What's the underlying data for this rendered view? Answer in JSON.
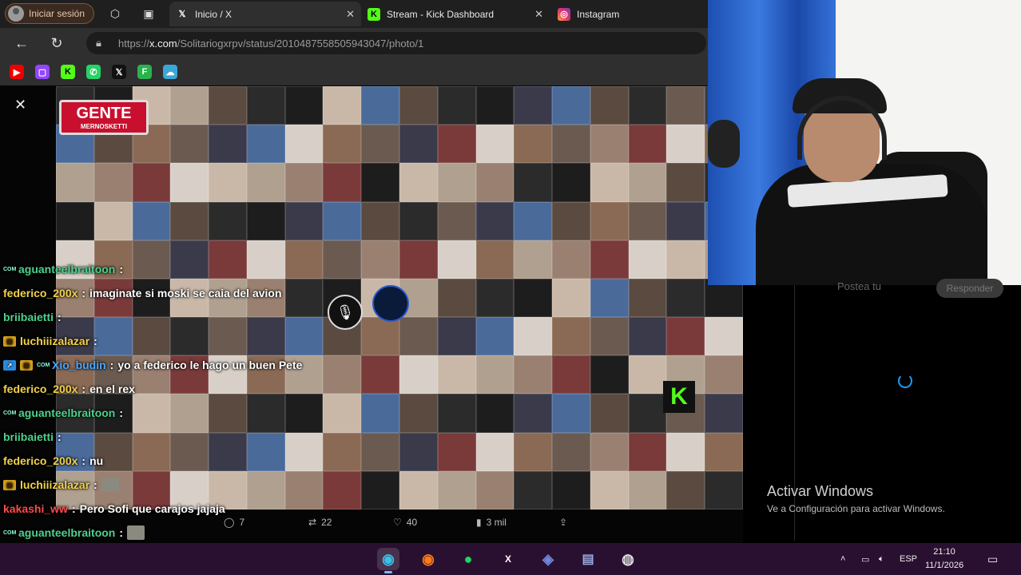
{
  "browser": {
    "profile_label": "Iniciar sesión",
    "tabs": [
      {
        "label": "Inicio / X",
        "icon": "x-logo-icon",
        "active": true
      },
      {
        "label": "Stream - Kick Dashboard",
        "icon": "kick-logo-icon",
        "active": false
      },
      {
        "label": "Instagram",
        "icon": "instagram-logo-icon",
        "active": false
      }
    ],
    "url_domain": "x.com",
    "url_prefix": "https://",
    "url_path": "/Solitariogxrpv/status/2010487558505943047/photo/1",
    "bookmarks": [
      "youtube",
      "twitch",
      "kick",
      "whatsapp",
      "x",
      "feedly",
      "cloud"
    ]
  },
  "post": {
    "banner_title": "GENTE",
    "banner_subtitle": "MERNOSKETTI",
    "actions": {
      "replies": "7",
      "reposts": "22",
      "likes": "40",
      "views": "3 mil"
    }
  },
  "chat": [
    {
      "user": "aguanteelbraitoon",
      "sep": ":",
      "text": "",
      "color": "green",
      "badges": [
        "com"
      ]
    },
    {
      "user": "federico_200x",
      "sep": ":",
      "text": "imaginate si moski se caia del avion",
      "color": "yellow",
      "badges": []
    },
    {
      "user": "briibaietti",
      "sep": ":",
      "text": "",
      "color": "green",
      "badges": []
    },
    {
      "user": "luchiiizalazar",
      "sep": ":",
      "text": "",
      "color": "yellow",
      "badges": [
        "gold"
      ]
    },
    {
      "user": "Xio_budin",
      "sep": ":",
      "text": "yo a federico le hago un buen Pete",
      "color": "blue",
      "badges": [
        "blue",
        "gold",
        "com"
      ]
    },
    {
      "user": "federico_200x",
      "sep": ":",
      "text": "en el rex",
      "color": "yellow",
      "badges": []
    },
    {
      "user": "aguanteelbraitoon",
      "sep": ":",
      "text": "",
      "color": "green",
      "badges": [
        "com"
      ]
    },
    {
      "user": "briibaietti",
      "sep": ":",
      "text": "",
      "color": "green",
      "badges": []
    },
    {
      "user": "federico_200x",
      "sep": ":",
      "text": "nu",
      "color": "yellow",
      "badges": []
    },
    {
      "user": "luchiiizalazar",
      "sep": ":",
      "text": "",
      "color": "yellow",
      "badges": [
        "gold"
      ]
    },
    {
      "user": "kakashi_ww",
      "sep": ":",
      "text": "Pero Sofi que carajos jajaja",
      "color": "red",
      "badges": []
    },
    {
      "user": "aguanteelbraitoon",
      "sep": ":",
      "text": "",
      "color": "green",
      "badges": [
        "com"
      ]
    },
    {
      "user": "luchiiizalazar",
      "sep": ":",
      "text": "",
      "color": "yellow",
      "badges": [
        "gold"
      ]
    }
  ],
  "side": {
    "reply_placeholder": "Postea tu",
    "reply_button": "Responder",
    "activate_title": "Activar Windows",
    "activate_subtitle": "Ve a Configuración para activar Windows."
  },
  "taskbar": {
    "language": "ESP",
    "time": "21:10",
    "date": "11/1/2026",
    "apps": [
      "edge",
      "firefox",
      "spotify",
      "xsplit",
      "discord",
      "notes",
      "obs"
    ]
  }
}
